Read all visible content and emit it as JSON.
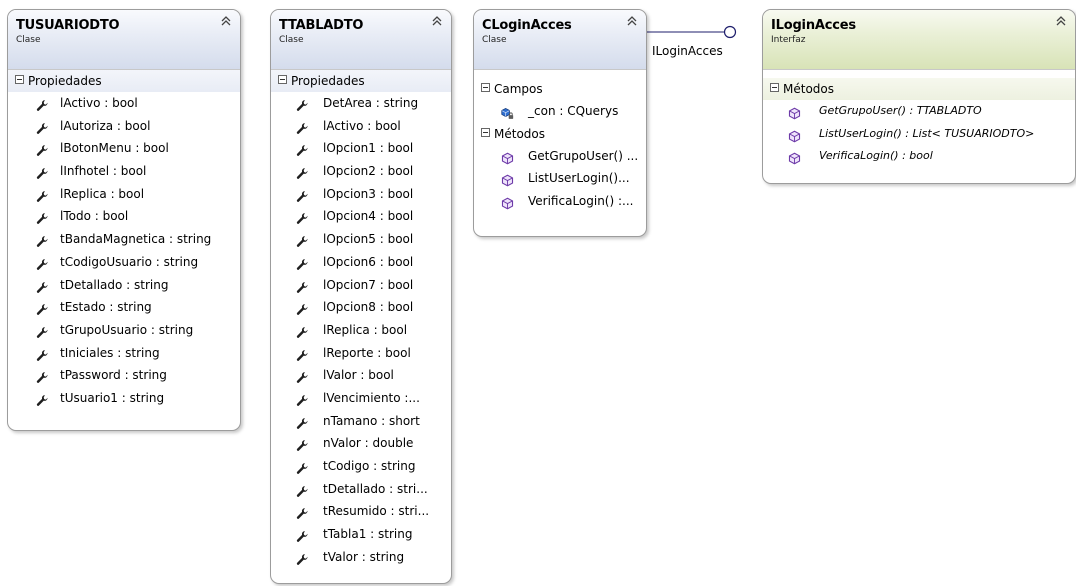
{
  "connector": {
    "label": "ILoginAcces"
  },
  "section_labels": {
    "properties": "Propiedades",
    "fields": "Campos",
    "methods": "Métodos"
  },
  "tusuariodto": {
    "name": "TUSUARIODTO",
    "kind": "Clase",
    "properties": [
      "lActivo : bool",
      "lAutoriza : bool",
      "lBotonMenu : bool",
      "lInfhotel : bool",
      "lReplica : bool",
      "lTodo : bool",
      "tBandaMagnetica : string",
      "tCodigoUsuario : string",
      "tDetallado : string",
      "tEstado : string",
      "tGrupoUsuario : string",
      "tIniciales : string",
      "tPassword : string",
      "tUsuario1 : string"
    ]
  },
  "ttabladto": {
    "name": "TTABLADTO",
    "kind": "Clase",
    "properties": [
      "DetArea : string",
      "lActivo : bool",
      "lOpcion1 : bool",
      "lOpcion2 : bool",
      "lOpcion3 : bool",
      "lOpcion4 : bool",
      "lOpcion5 : bool",
      "lOpcion6 : bool",
      "lOpcion7 : bool",
      "lOpcion8 : bool",
      "lReplica : bool",
      "lReporte : bool",
      "lValor : bool",
      "lVencimiento  :...",
      "nTamano : short",
      "nValor : double",
      "tCodigo : string",
      "tDetallado  : stri...",
      "tResumido  : stri...",
      "tTabla1 : string",
      "tValor : string"
    ]
  },
  "cloginacces": {
    "name": "CLoginAcces",
    "kind": "Clase",
    "fields": [
      "_con : CQuerys"
    ],
    "methods": [
      "GetGrupoUser() ...",
      "ListUserLogin()...",
      "VerificaLogin() :..."
    ]
  },
  "iloginacces": {
    "name": "ILoginAcces",
    "kind": "Interfaz",
    "methods": [
      "GetGrupoUser() : TTABLADTO",
      "ListUserLogin() : List< TUSUARIODTO>",
      "VerificaLogin() : bool"
    ]
  }
}
